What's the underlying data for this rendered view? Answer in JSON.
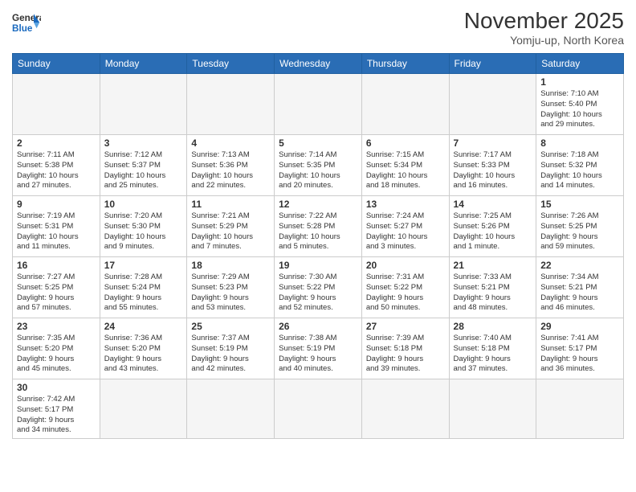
{
  "header": {
    "logo_general": "General",
    "logo_blue": "Blue",
    "month_title": "November 2025",
    "location": "Yomju-up, North Korea"
  },
  "days_of_week": [
    "Sunday",
    "Monday",
    "Tuesday",
    "Wednesday",
    "Thursday",
    "Friday",
    "Saturday"
  ],
  "weeks": [
    [
      {
        "day": "",
        "info": "",
        "empty": true
      },
      {
        "day": "",
        "info": "",
        "empty": true
      },
      {
        "day": "",
        "info": "",
        "empty": true
      },
      {
        "day": "",
        "info": "",
        "empty": true
      },
      {
        "day": "",
        "info": "",
        "empty": true
      },
      {
        "day": "",
        "info": "",
        "empty": true
      },
      {
        "day": "1",
        "info": "Sunrise: 7:10 AM\nSunset: 5:40 PM\nDaylight: 10 hours\nand 29 minutes.",
        "empty": false
      }
    ],
    [
      {
        "day": "2",
        "info": "Sunrise: 7:11 AM\nSunset: 5:38 PM\nDaylight: 10 hours\nand 27 minutes.",
        "empty": false
      },
      {
        "day": "3",
        "info": "Sunrise: 7:12 AM\nSunset: 5:37 PM\nDaylight: 10 hours\nand 25 minutes.",
        "empty": false
      },
      {
        "day": "4",
        "info": "Sunrise: 7:13 AM\nSunset: 5:36 PM\nDaylight: 10 hours\nand 22 minutes.",
        "empty": false
      },
      {
        "day": "5",
        "info": "Sunrise: 7:14 AM\nSunset: 5:35 PM\nDaylight: 10 hours\nand 20 minutes.",
        "empty": false
      },
      {
        "day": "6",
        "info": "Sunrise: 7:15 AM\nSunset: 5:34 PM\nDaylight: 10 hours\nand 18 minutes.",
        "empty": false
      },
      {
        "day": "7",
        "info": "Sunrise: 7:17 AM\nSunset: 5:33 PM\nDaylight: 10 hours\nand 16 minutes.",
        "empty": false
      },
      {
        "day": "8",
        "info": "Sunrise: 7:18 AM\nSunset: 5:32 PM\nDaylight: 10 hours\nand 14 minutes.",
        "empty": false
      }
    ],
    [
      {
        "day": "9",
        "info": "Sunrise: 7:19 AM\nSunset: 5:31 PM\nDaylight: 10 hours\nand 11 minutes.",
        "empty": false
      },
      {
        "day": "10",
        "info": "Sunrise: 7:20 AM\nSunset: 5:30 PM\nDaylight: 10 hours\nand 9 minutes.",
        "empty": false
      },
      {
        "day": "11",
        "info": "Sunrise: 7:21 AM\nSunset: 5:29 PM\nDaylight: 10 hours\nand 7 minutes.",
        "empty": false
      },
      {
        "day": "12",
        "info": "Sunrise: 7:22 AM\nSunset: 5:28 PM\nDaylight: 10 hours\nand 5 minutes.",
        "empty": false
      },
      {
        "day": "13",
        "info": "Sunrise: 7:24 AM\nSunset: 5:27 PM\nDaylight: 10 hours\nand 3 minutes.",
        "empty": false
      },
      {
        "day": "14",
        "info": "Sunrise: 7:25 AM\nSunset: 5:26 PM\nDaylight: 10 hours\nand 1 minute.",
        "empty": false
      },
      {
        "day": "15",
        "info": "Sunrise: 7:26 AM\nSunset: 5:25 PM\nDaylight: 9 hours\nand 59 minutes.",
        "empty": false
      }
    ],
    [
      {
        "day": "16",
        "info": "Sunrise: 7:27 AM\nSunset: 5:25 PM\nDaylight: 9 hours\nand 57 minutes.",
        "empty": false
      },
      {
        "day": "17",
        "info": "Sunrise: 7:28 AM\nSunset: 5:24 PM\nDaylight: 9 hours\nand 55 minutes.",
        "empty": false
      },
      {
        "day": "18",
        "info": "Sunrise: 7:29 AM\nSunset: 5:23 PM\nDaylight: 9 hours\nand 53 minutes.",
        "empty": false
      },
      {
        "day": "19",
        "info": "Sunrise: 7:30 AM\nSunset: 5:22 PM\nDaylight: 9 hours\nand 52 minutes.",
        "empty": false
      },
      {
        "day": "20",
        "info": "Sunrise: 7:31 AM\nSunset: 5:22 PM\nDaylight: 9 hours\nand 50 minutes.",
        "empty": false
      },
      {
        "day": "21",
        "info": "Sunrise: 7:33 AM\nSunset: 5:21 PM\nDaylight: 9 hours\nand 48 minutes.",
        "empty": false
      },
      {
        "day": "22",
        "info": "Sunrise: 7:34 AM\nSunset: 5:21 PM\nDaylight: 9 hours\nand 46 minutes.",
        "empty": false
      }
    ],
    [
      {
        "day": "23",
        "info": "Sunrise: 7:35 AM\nSunset: 5:20 PM\nDaylight: 9 hours\nand 45 minutes.",
        "empty": false
      },
      {
        "day": "24",
        "info": "Sunrise: 7:36 AM\nSunset: 5:20 PM\nDaylight: 9 hours\nand 43 minutes.",
        "empty": false
      },
      {
        "day": "25",
        "info": "Sunrise: 7:37 AM\nSunset: 5:19 PM\nDaylight: 9 hours\nand 42 minutes.",
        "empty": false
      },
      {
        "day": "26",
        "info": "Sunrise: 7:38 AM\nSunset: 5:19 PM\nDaylight: 9 hours\nand 40 minutes.",
        "empty": false
      },
      {
        "day": "27",
        "info": "Sunrise: 7:39 AM\nSunset: 5:18 PM\nDaylight: 9 hours\nand 39 minutes.",
        "empty": false
      },
      {
        "day": "28",
        "info": "Sunrise: 7:40 AM\nSunset: 5:18 PM\nDaylight: 9 hours\nand 37 minutes.",
        "empty": false
      },
      {
        "day": "29",
        "info": "Sunrise: 7:41 AM\nSunset: 5:17 PM\nDaylight: 9 hours\nand 36 minutes.",
        "empty": false
      }
    ],
    [
      {
        "day": "30",
        "info": "Sunrise: 7:42 AM\nSunset: 5:17 PM\nDaylight: 9 hours\nand 34 minutes.",
        "empty": false
      },
      {
        "day": "",
        "info": "",
        "empty": true
      },
      {
        "day": "",
        "info": "",
        "empty": true
      },
      {
        "day": "",
        "info": "",
        "empty": true
      },
      {
        "day": "",
        "info": "",
        "empty": true
      },
      {
        "day": "",
        "info": "",
        "empty": true
      },
      {
        "day": "",
        "info": "",
        "empty": true
      }
    ]
  ]
}
